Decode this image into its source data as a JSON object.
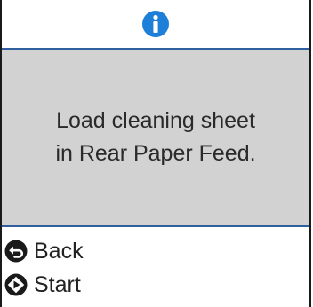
{
  "header": {
    "icon": "info-icon",
    "icon_color": "#1e7fd8"
  },
  "message": {
    "line1": "Load cleaning sheet",
    "line2": "in Rear Paper Feed."
  },
  "actions": [
    {
      "icon": "back-icon",
      "label": "Back"
    },
    {
      "icon": "start-icon",
      "label": "Start"
    }
  ],
  "colors": {
    "message_background": "#d2d2d2",
    "divider": "#2f5f9e"
  }
}
